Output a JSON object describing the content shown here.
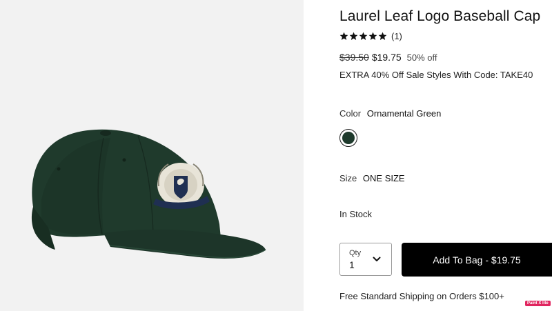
{
  "product": {
    "image_alt": "Green baseball cap with laurel leaf crest logo",
    "title": "Laurel Leaf Logo Baseball Cap",
    "rating": 5,
    "review_count": "(1)",
    "price_original": "$39.50",
    "price_sale": "$19.75",
    "discount": "50% off",
    "promo": "EXTRA 40% Off Sale Styles With Code: TAKE40",
    "color_label": "Color",
    "color_value": "Ornamental Green",
    "swatch_color": "#1e3a2c",
    "size_label": "Size",
    "size_value": "ONE SIZE",
    "stock": "In Stock"
  },
  "purchase": {
    "qty_label": "Qty",
    "qty_value": "1",
    "add_button": "Add To Bag - $19.75"
  },
  "shipping": "Free Standard Shipping on Orders $100+",
  "badge": "Paint X lite",
  "colors": {
    "cap_green": "#1f3a2c",
    "button_black": "#000000",
    "background_gray": "#f2f2f2"
  }
}
